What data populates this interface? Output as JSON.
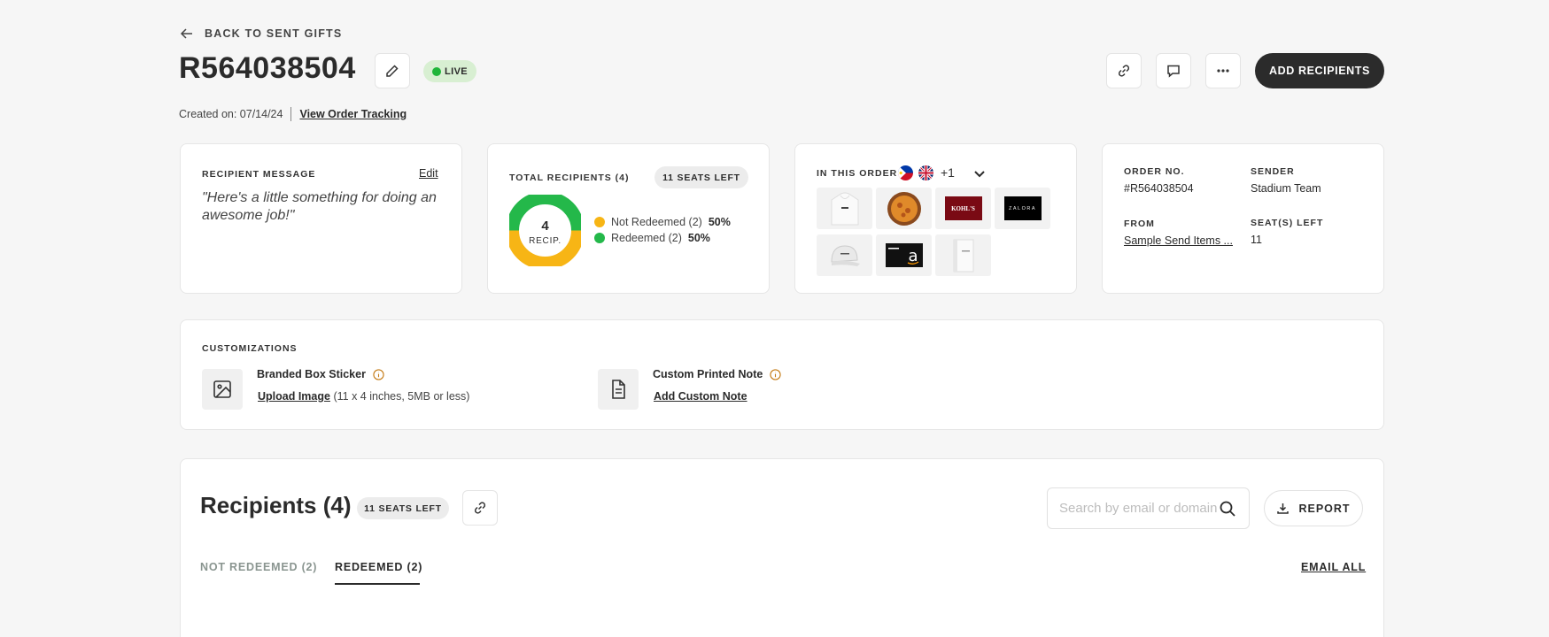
{
  "header": {
    "back_label": "BACK TO SENT GIFTS",
    "order_title": "R564038504",
    "status": "LIVE",
    "created_label": "Created on: 07/14/24",
    "tracking_link": "View Order Tracking",
    "add_recipients_label": "ADD RECIPIENTS"
  },
  "message_card": {
    "label": "RECIPIENT MESSAGE",
    "edit_label": "Edit",
    "message": "\"Here's a little something for doing an awesome job!\""
  },
  "recipients_card": {
    "label": "TOTAL RECIPIENTS (4)",
    "seats_badge": "11 SEATS LEFT",
    "donut_number": "4",
    "donut_caption": "RECIP.",
    "legend": [
      {
        "label": "Not Redeemed (2)",
        "pct": "50%",
        "color": "#f7b515",
        "value": 2
      },
      {
        "label": "Redeemed (2)",
        "pct": "50%",
        "color": "#24b84a",
        "value": 2
      }
    ]
  },
  "order_card": {
    "label": "IN THIS ORDER",
    "more_count": "+1",
    "items": [
      "hoodie",
      "pie",
      "kohls-card",
      "zalora-card",
      "cap",
      "amazon-card",
      "notebook"
    ],
    "kohls_text": "KOHL'S",
    "zalora_text": "ZALORA"
  },
  "meta_card": {
    "order_no_label": "ORDER NO.",
    "order_no": "#R564038504",
    "sender_label": "SENDER",
    "sender": "Stadium Team",
    "from_label": "FROM",
    "from_link": "Sample Send Items ...",
    "seats_left_label": "SEAT(S) LEFT",
    "seats_left": "11"
  },
  "customizations": {
    "label": "CUSTOMIZATIONS",
    "sticker_title": "Branded Box Sticker",
    "sticker_link": "Upload Image",
    "sticker_hint": "(11 x 4 inches, 5MB or less)",
    "note_title": "Custom Printed Note",
    "note_link": "Add Custom Note"
  },
  "recipients_section": {
    "title": "Recipients (4)",
    "seats_badge": "11 SEATS LEFT",
    "search_placeholder": "Search by email or domain",
    "report_label": "REPORT",
    "tabs": [
      {
        "label": "NOT REDEEMED (2)",
        "active": false
      },
      {
        "label": "REDEEMED (2)",
        "active": true
      }
    ],
    "email_all_label": "EMAIL ALL"
  },
  "colors": {
    "accent_dark": "#2b2b2b",
    "live_green": "#20b53a",
    "not_redeemed": "#f7b515",
    "redeemed": "#24b84a"
  }
}
